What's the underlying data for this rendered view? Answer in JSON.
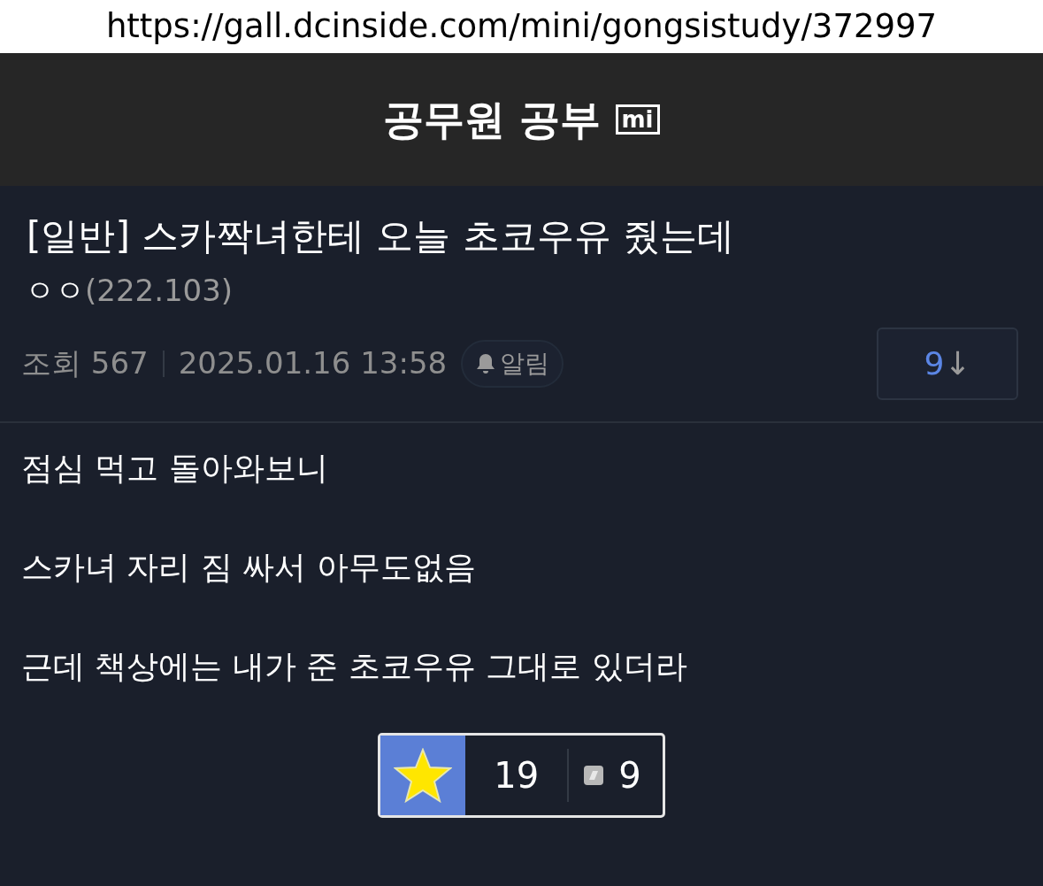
{
  "url": "https://gall.dcinside.com/mini/gongsistudy/372997",
  "gallery": {
    "title": "공무원 공부",
    "badge": "mi"
  },
  "post": {
    "title": "[일반] 스카짝녀한테 오늘 초코우유 줬는데",
    "author": "ㅇㅇ",
    "ip": "(222.103)",
    "views": "조회 567",
    "date": "2025.01.16 13:58",
    "alert": "알림",
    "comment_count": "9",
    "comment_arrow": "↓",
    "paragraphs": [
      "점심 먹고 돌아와보니",
      "스카녀 자리 짐 싸서 아무도없음",
      "근데 책상에는 내가 준 초코우유 그대로 있더라"
    ],
    "recommend": "19",
    "fixed_recommend": "9"
  }
}
